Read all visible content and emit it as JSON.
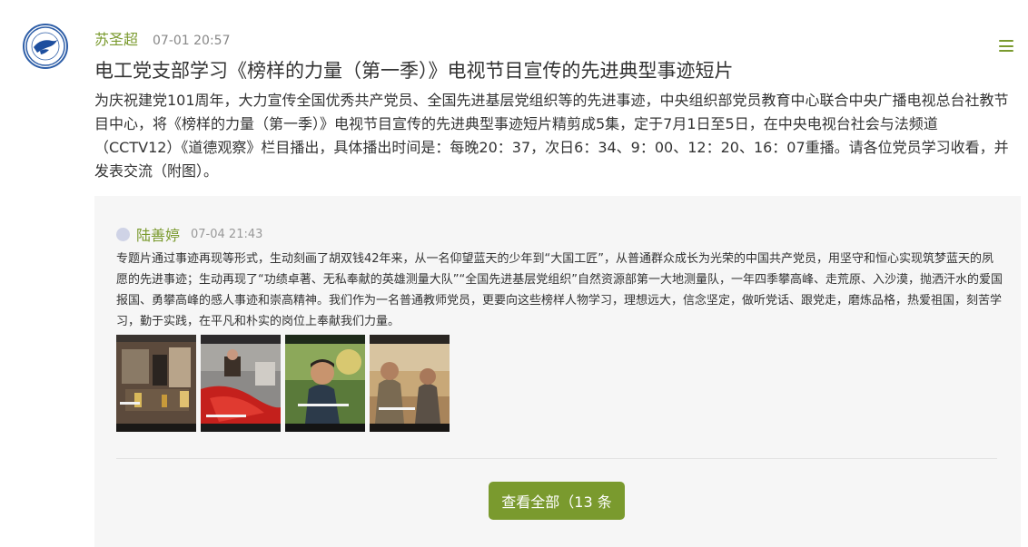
{
  "post": {
    "author": "苏圣超",
    "time": "07-01 20:57",
    "title": "电工党支部学习《榜样的力量（第一季）》电视节目宣传的先进典型事迹短片",
    "body": "为庆祝建党101周年，大力宣传全国优秀共产党员、全国先进基层党组织等的先进事迹，中央组织部党员教育中心联合中央广播电视总台社教节目中心，将《榜样的力量（第一季）》电视节目宣传的先进典型事迹短片精剪成5集，定于7月1日至5日，在中央电视台社会与法频道（CCTV12）《道德观察》栏目播出，具体播出时间是：每晚20：37，次日6：34、9：00、12：20、16：07重播。请各位党员学习收看，并发表交流（附图）。"
  },
  "comment": {
    "author": "陆善婷",
    "time": "07-04 21:43",
    "text": "专题片通过事迹再现等形式，生动刻画了胡双钱42年来，从一名仰望蓝天的少年到“大国工匠”，从普通群众成长为光荣的中国共产党员，用坚守和恒心实现筑梦蓝天的夙愿的先进事迹；生动再现了“功绩卓著、无私奉献的英雄测量大队”“全国先进基层党组织”自然资源部第一大地测量队，一年四季攀高峰、走荒原、入沙漠，抛洒汗水的爱国报国、勇攀高峰的感人事迹和崇高精神。我们作为一名普通教师党员，更要向这些榜样人物学习，理想远大，信念坚定，做听党话、跟党走，磨炼品格，热爱祖国，刻苦学习，勤于实践，在平凡和朴实的岗位上奉献我们力量。",
    "photos": [
      "tv-photo-1",
      "tv-photo-2",
      "tv-photo-3",
      "tv-photo-4"
    ]
  },
  "view_all_label": "查看全部（13 条",
  "icons": {
    "avatar": "school-logo-icon",
    "menu": "menu-icon"
  },
  "colors": {
    "accent": "#7a9a2e",
    "panel": "#f6f6f6"
  }
}
